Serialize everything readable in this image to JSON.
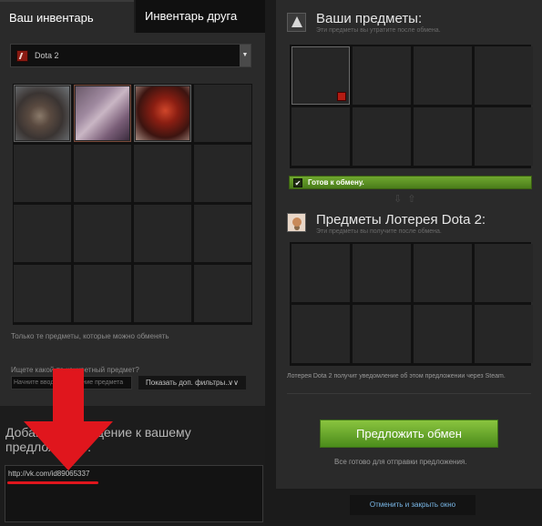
{
  "tabs": {
    "my_inventory": "Ваш инвентарь",
    "friend_inventory": "Инвентарь друга"
  },
  "game_select": {
    "value": "Dota 2",
    "icon": "dota2-icon"
  },
  "inventory": {
    "hint_tradable": "Только те предметы, которые можно обменять",
    "search_label": "Ищете какой-то конкретный предмет?",
    "search_placeholder": "Начните вводить название предмета",
    "filters_button": "Показать доп. фильтры...",
    "filters_chevron": "∨∨"
  },
  "message": {
    "title": "Добавить сообщение к вашему предложению:",
    "value": "http://vk.com/id89065337"
  },
  "my_items": {
    "title": "Ваши предметы:",
    "subtitle": "Эти предметы вы утратите после обмена."
  },
  "ready": {
    "check": "✔",
    "label": "Готов к обмену."
  },
  "swap_arrows": "⇩⇧",
  "their_items": {
    "title": "Предметы Лотерея Dota 2:",
    "subtitle": "Эти предметы вы получите после обмена."
  },
  "notify_text": "Лотерея Dota 2 получит уведомление об этом предложении через Steam.",
  "offer_button": "Предложить обмен",
  "ready_to_send": "Все готово для отправки предложения.",
  "cancel_link": "Отменить и закрыть окно",
  "colors": {
    "accent_green": "#6fa72f",
    "link_blue": "#7ab8e8",
    "annotation_red": "#e0161d"
  }
}
